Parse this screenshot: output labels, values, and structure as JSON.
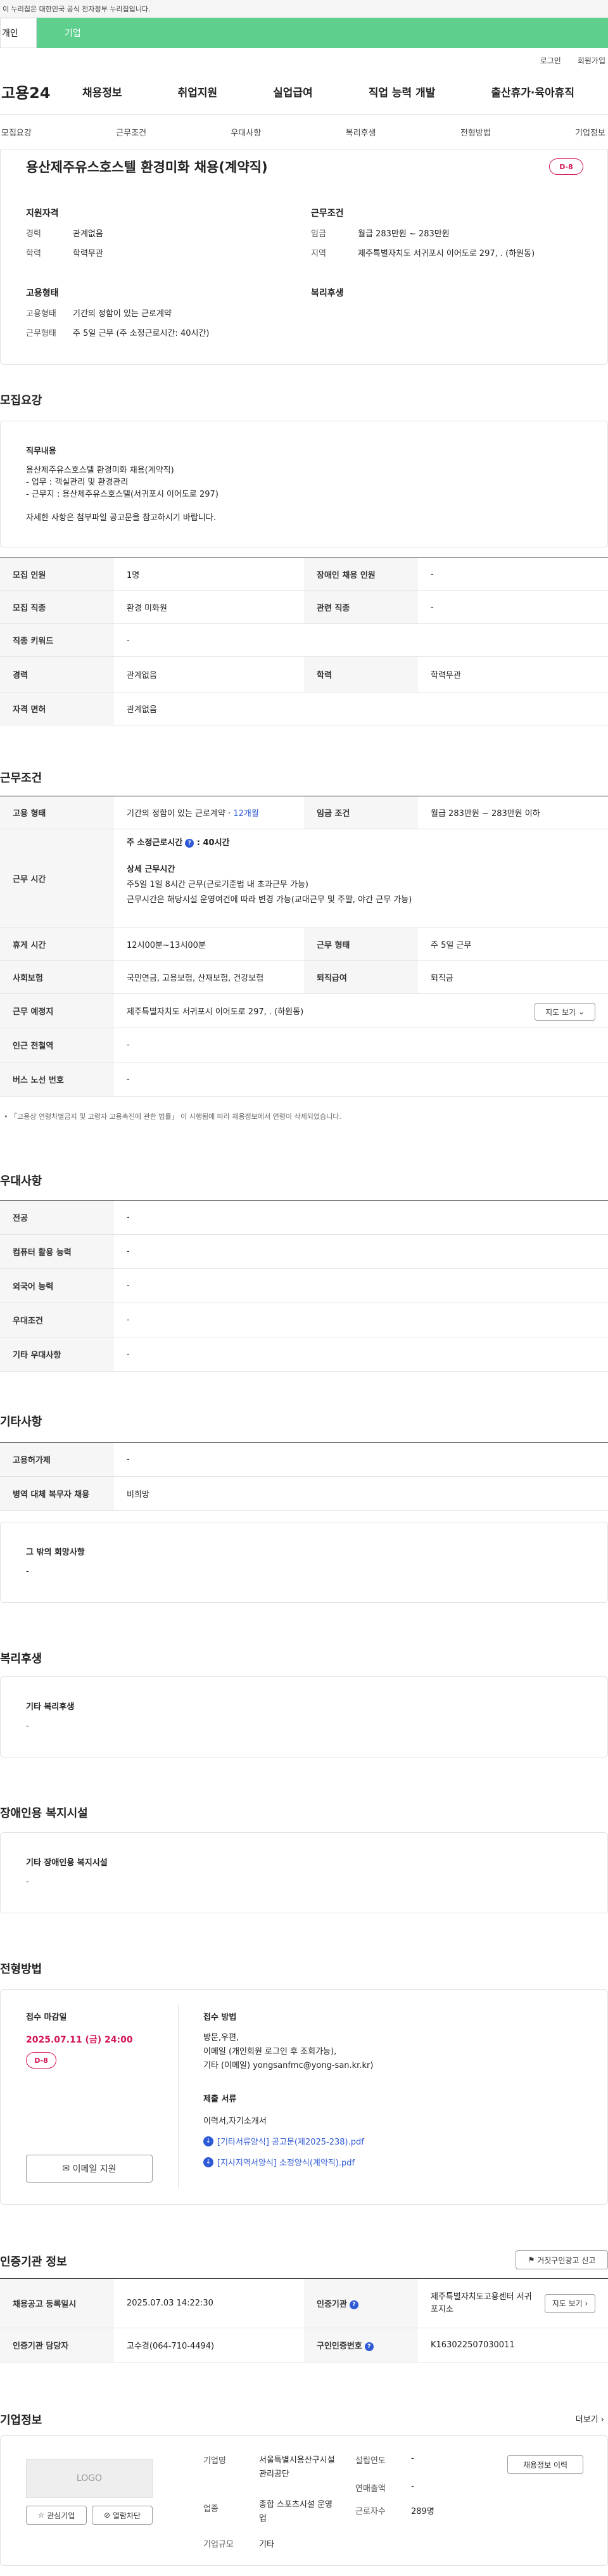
{
  "gov_bar": {
    "text": "이 누리집은 대한민국 공식 전자정부 누리집입니다."
  },
  "tabs": {
    "person": "개인",
    "company": "기업"
  },
  "util": {
    "login": "로그인",
    "join": "회원가입"
  },
  "gnb": {
    "logo": "고용24",
    "items": [
      "채용정보",
      "취업지원",
      "실업급여",
      "직업 능력 개발",
      "출산휴가·육아휴직"
    ]
  },
  "subnav": [
    "모집요강",
    "근무조건",
    "우대사항",
    "복리후생",
    "전형방법",
    "기업정보"
  ],
  "summary": {
    "title": "용산제주유스호스텔 환경미화 채용(계약직)",
    "dday": "D-8",
    "qual_head": "지원자격",
    "career_label": "경력",
    "career": "관계없음",
    "edu_label": "학력",
    "edu": "학력무관",
    "cond_head": "근무조건",
    "wage_label": "임금",
    "wage": "월급 283만원 ~ 283만원",
    "area_label": "지역",
    "area": "제주특별자치도 서귀포시 이어도로 297, . (하원동)",
    "emp_head": "고용형태",
    "emptype_label": "고용형태",
    "emptype": "기간의 정함이 있는 근로계약",
    "worktype_label": "근무형태",
    "worktype": "주 5일 근무 (주 소정근로시간: 40시간)",
    "welfare_head": "복리후생"
  },
  "recruit": {
    "title": "모집요강",
    "job_head": "직무내용",
    "job_lines": [
      "용산제주유스호스텔 환경미화 채용(계약직)",
      "- 업무 : 객실관리 및 환경관리",
      "- 근무지 : 용산제주유스호스텔(서귀포시 이어도로 297)"
    ],
    "job_note": "자세한 사항은 첨부파일 공고문을 참고하시기 바랍니다.",
    "rows": [
      {
        "l1": "모집 인원",
        "v1": "1명",
        "l2": "장애인 채용 인원",
        "v2": "-"
      },
      {
        "l1": "모집 직종",
        "v1": "환경 미화원",
        "l2": "관련 직종",
        "v2": "-"
      },
      {
        "l1": "직종 키워드",
        "v1": "-"
      },
      {
        "l1": "경력",
        "v1": "관계없음",
        "l2": "학력",
        "v2": "학력무관"
      },
      {
        "l1": "자격 면허",
        "v1": "관계없음"
      }
    ]
  },
  "conditions": {
    "title": "근무조건",
    "emp_label": "고용 형태",
    "emp_value": "기간의 정함이 있는 근로계약 · ",
    "emp_months": "12개월",
    "wage_label": "임금 조건",
    "wage_value": "월급 283만원 ~ 283만원 이하",
    "hours_label": "근무 시간",
    "hours_main": "주 소정근로시간",
    "hours_main_value": ": 40시간",
    "hours_detail_head": "상세 근무시간",
    "hours_detail_1": "주5일 1일 8시간 근무(근로기준법 내 초과근무 가능)",
    "hours_detail_2": "근무시간은 해당시설 운영여건에 따라 변경 가능(교대근무 및 주말, 야간 근무 가능)",
    "break_label": "휴게 시간",
    "break_value": "12시00분~13시00분",
    "form_label": "근무 형태",
    "form_value": "주 5일 근무",
    "insurance_label": "사회보험",
    "insurance_value": "국민연금, 고용보험, 산재보험, 건강보험",
    "severance_label": "퇴직급여",
    "severance_value": "퇴직금",
    "place_label": "근무 예정지",
    "place_value": "제주특별자치도 서귀포시 이어도로 297, . (하원동)",
    "map_btn": "지도 보기",
    "station_label": "인근 전철역",
    "station_value": "-",
    "bus_label": "버스 노선 번호",
    "bus_value": "-",
    "note": "「고용상 연령차별금지 및 고령자 고용촉진에 관한 법률」 이 시행됨에 따라 채용정보에서 연령이 삭제되었습니다."
  },
  "preference": {
    "title": "우대사항",
    "rows": [
      {
        "l": "전공",
        "v": "-"
      },
      {
        "l": "컴퓨터 활용 능력",
        "v": "-"
      },
      {
        "l": "외국어 능력",
        "v": "-"
      },
      {
        "l": "우대조건",
        "v": "-"
      },
      {
        "l": "기타 우대사항",
        "v": "-"
      }
    ]
  },
  "etc": {
    "title": "기타사항",
    "rows": [
      {
        "l": "고용허가제",
        "v": "-"
      },
      {
        "l": "병역 대체 복무자 채용",
        "v": "비희망"
      }
    ],
    "other_head": "그 밖의 희망사항",
    "other_value": "-"
  },
  "welfare": {
    "title": "복리후생",
    "head": "기타 복리후생",
    "value": "-"
  },
  "disability": {
    "title": "장애인용 복지시설",
    "head": "기타 장애인용 복지시설",
    "value": "-"
  },
  "selection": {
    "title": "전형방법",
    "deadline_head": "접수 마감일",
    "deadline": "2025.07.11 (금) 24:00",
    "dday": "D-8",
    "email_btn": "이메일 지원",
    "method_head": "접수 방법",
    "method_lines": [
      "방문,우편,",
      "이메일 (개인회원 로그인 후 조회가능),",
      "기타 (이메일) yongsanfmc@yong-san.kr.kr)"
    ],
    "docs_head": "제출 서류",
    "docs_value": "이력서,자기소개서",
    "files": [
      "[기타서류양식] 공고문(제2025-238).pdf",
      "[지사지역서양식] 소정양식(계약직).pdf"
    ]
  },
  "certify": {
    "title": "인증기관 정보",
    "report_btn": "거짓구인광고 신고",
    "date_label": "채용공고 등록일시",
    "date_value": "2025.07.03 14:22:30",
    "agency_label": "인증기관",
    "agency_value": "제주특별자치도고용센터 서귀포지소",
    "map_btn": "지도 보기",
    "manager_label": "인증기관 담당자",
    "manager_value": "고수경(064-710-4494)",
    "no_label": "구인인증번호",
    "no_value": "K163022507030011"
  },
  "company": {
    "title": "기업정보",
    "more": "더보기",
    "logo": "LOGO",
    "interest_btn": "관심기업",
    "block_btn": "열람차단",
    "name_label": "기업명",
    "name_value": "서울특별시용산구시설관리공단",
    "year_label": "설립연도",
    "year_value": "-",
    "industry_label": "업종",
    "industry_value": "종합 스포츠시설 운영업",
    "sales_label": "연매출액",
    "sales_value": "-",
    "workers_label": "근로자수",
    "workers_value": "289명",
    "size_label": "기업규모",
    "size_value": "기타",
    "jobs_btn": "채용정보 이력"
  }
}
